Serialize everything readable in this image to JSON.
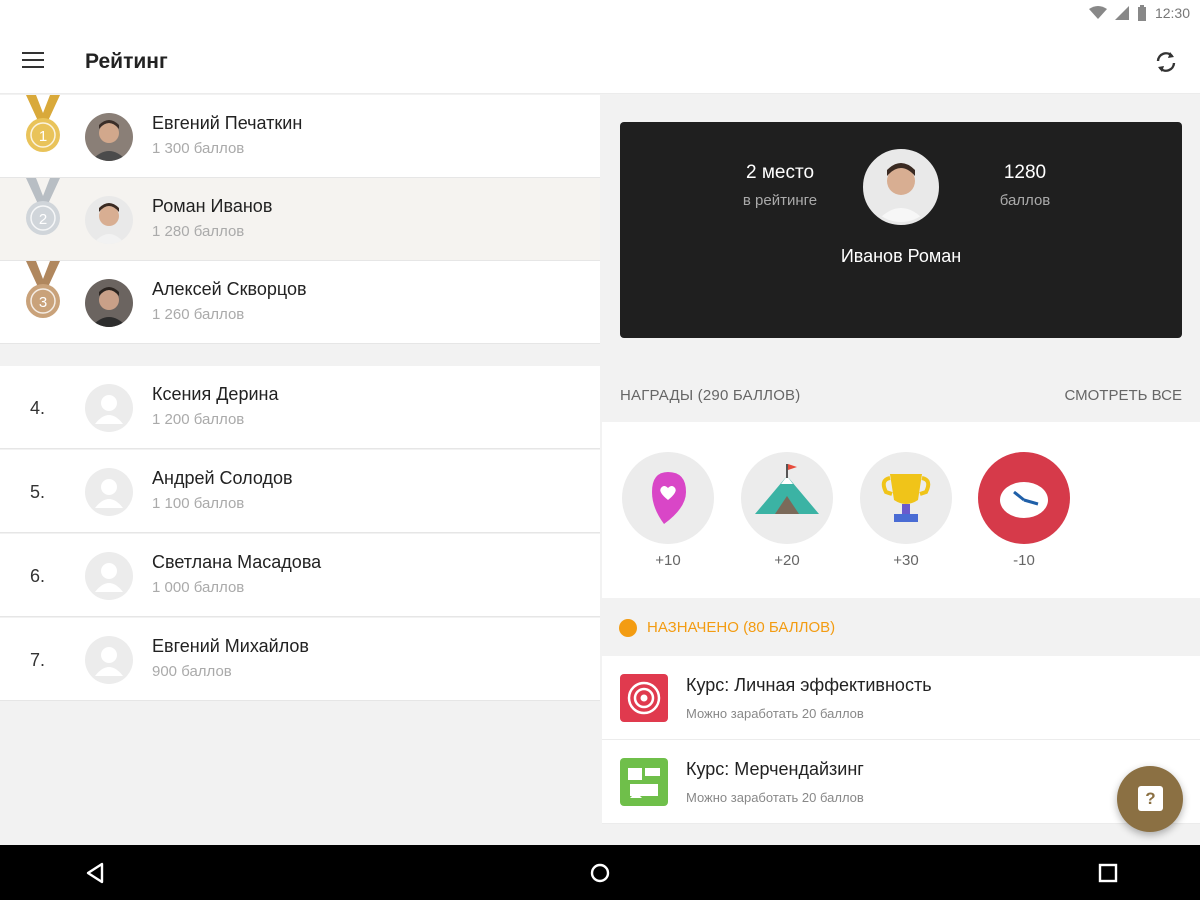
{
  "status_bar": {
    "time": "12:30"
  },
  "app_bar": {
    "title": "Рейтинг"
  },
  "leaderboard": {
    "top": [
      {
        "name": "Евгений Печаткин",
        "points": "1 300 баллов",
        "medal": "1",
        "medal_color": "#e0b94a"
      },
      {
        "name": "Роман Иванов",
        "points": "1 280 баллов",
        "medal": "2",
        "medal_color": "#c6cbd0"
      },
      {
        "name": "Алексей Скворцов",
        "points": "1 260 баллов",
        "medal": "3",
        "medal_color": "#c79a6b"
      }
    ],
    "rest": [
      {
        "rank": "4.",
        "name": "Ксения Дерина",
        "points": "1 200 баллов"
      },
      {
        "rank": "5.",
        "name": "Андрей Солодов",
        "points": "1 100 баллов"
      },
      {
        "rank": "6.",
        "name": "Светлана Масадова",
        "points": "1 000 баллов"
      },
      {
        "rank": "7.",
        "name": "Евгений Михайлов",
        "points": "900 баллов"
      }
    ]
  },
  "profile": {
    "place_value": "2 место",
    "place_label": "в рейтинге",
    "points_value": "1280",
    "points_label": "баллов",
    "name": "Иванов Роман"
  },
  "awards": {
    "header": "НАГРАДЫ (290 БАЛЛОВ)",
    "see_all": "СМОТРЕТЬ ВСЕ",
    "items": [
      {
        "icon": "heart-pin-icon",
        "value": "+10"
      },
      {
        "icon": "mountain-flag-icon",
        "value": "+20"
      },
      {
        "icon": "trophy-icon",
        "value": "+30"
      },
      {
        "icon": "clock-icon",
        "value": "-10"
      }
    ]
  },
  "assigned": {
    "label": "НАЗНАЧЕНО (80 БАЛЛОВ)",
    "accent": "#f39c12",
    "courses": [
      {
        "title": "Курс: Личная эффективность",
        "subtitle": "Можно заработать 20 баллов",
        "icon": "target-icon"
      },
      {
        "title": "Курс: Мерчендайзинг",
        "subtitle": "Можно заработать 20 баллов",
        "icon": "merchandising-icon"
      }
    ]
  },
  "fab": {
    "label": "?",
    "color": "#8b7043"
  }
}
